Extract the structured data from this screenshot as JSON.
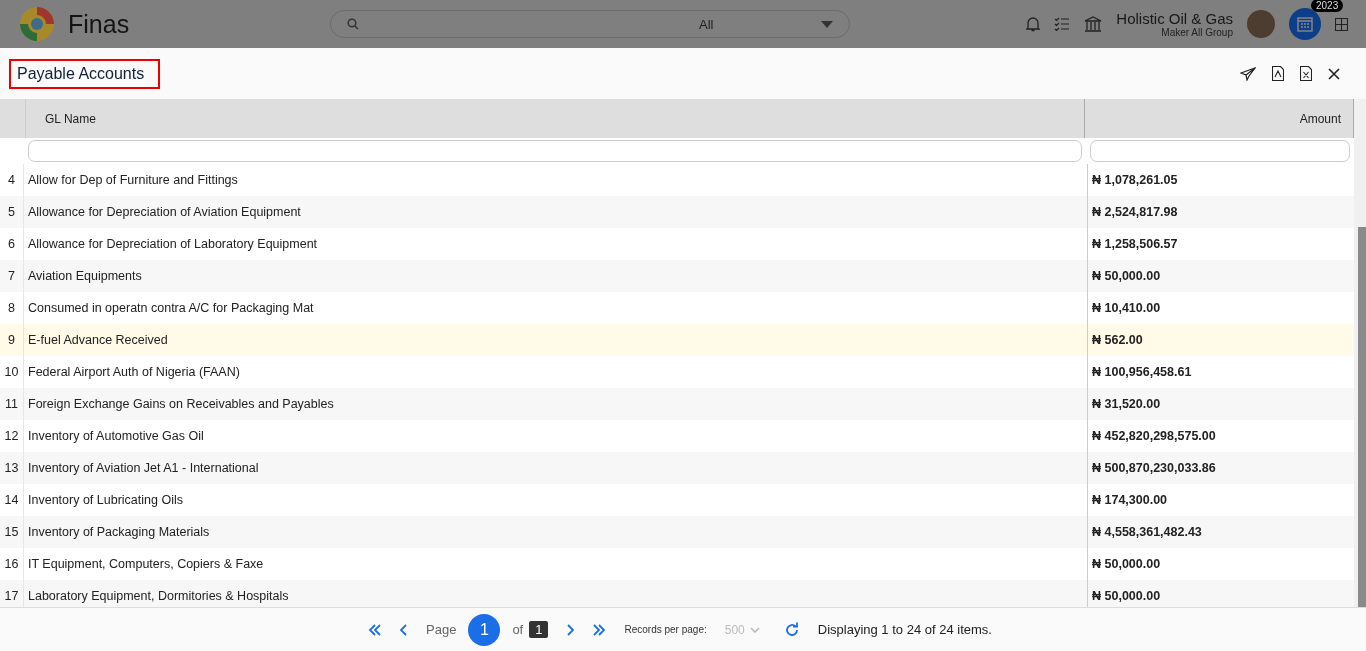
{
  "app": {
    "name": "Finas"
  },
  "search": {
    "scope": "All"
  },
  "company": {
    "name": "Holistic Oil & Gas",
    "group": "Maker All Group"
  },
  "year_badge": "2023",
  "panel": {
    "title": "Payable Accounts"
  },
  "table": {
    "columns": [
      "GL Name",
      "Amount"
    ],
    "rows": [
      {
        "no": "4",
        "name": "Allow for Dep of Furniture and Fittings",
        "amount": "₦ 1,078,261.05",
        "selected": false
      },
      {
        "no": "5",
        "name": "Allowance for Depreciation of Aviation Equipment",
        "amount": "₦ 2,524,817.98",
        "selected": false
      },
      {
        "no": "6",
        "name": "Allowance for Depreciation of Laboratory Equipment",
        "amount": "₦ 1,258,506.57",
        "selected": false
      },
      {
        "no": "7",
        "name": "Aviation Equipments",
        "amount": "₦ 50,000.00",
        "selected": false
      },
      {
        "no": "8",
        "name": "Consumed in operatn contra A/C for Packaging Mat",
        "amount": "₦ 10,410.00",
        "selected": false
      },
      {
        "no": "9",
        "name": "E-fuel Advance Received",
        "amount": "₦ 562.00",
        "selected": true
      },
      {
        "no": "10",
        "name": "Federal Airport Auth of Nigeria (FAAN)",
        "amount": "₦ 100,956,458.61",
        "selected": false
      },
      {
        "no": "11",
        "name": "Foreign Exchange Gains on Receivables and Payables",
        "amount": "₦ 31,520.00",
        "selected": false
      },
      {
        "no": "12",
        "name": "Inventory of Automotive Gas Oil",
        "amount": "₦ 452,820,298,575.00",
        "selected": false
      },
      {
        "no": "13",
        "name": "Inventory of Aviation Jet A1 - International",
        "amount": "₦ 500,870,230,033.86",
        "selected": false
      },
      {
        "no": "14",
        "name": "Inventory of Lubricating Oils",
        "amount": "₦ 174,300.00",
        "selected": false
      },
      {
        "no": "15",
        "name": "Inventory of Packaging Materials",
        "amount": "₦ 4,558,361,482.43",
        "selected": false
      },
      {
        "no": "16",
        "name": "IT Equipment, Computers, Copiers & Faxe",
        "amount": "₦ 50,000.00",
        "selected": false
      },
      {
        "no": "17",
        "name": "Laboratory Equipment, Dormitories & Hospitals",
        "amount": "₦ 50,000.00",
        "selected": false
      }
    ]
  },
  "pager": {
    "page_label": "Page",
    "page": "1",
    "of_label": "of",
    "total": "1",
    "records_label": "Records per page:",
    "records": "500",
    "summary": "Displaying 1 to 24 of 24 items."
  }
}
